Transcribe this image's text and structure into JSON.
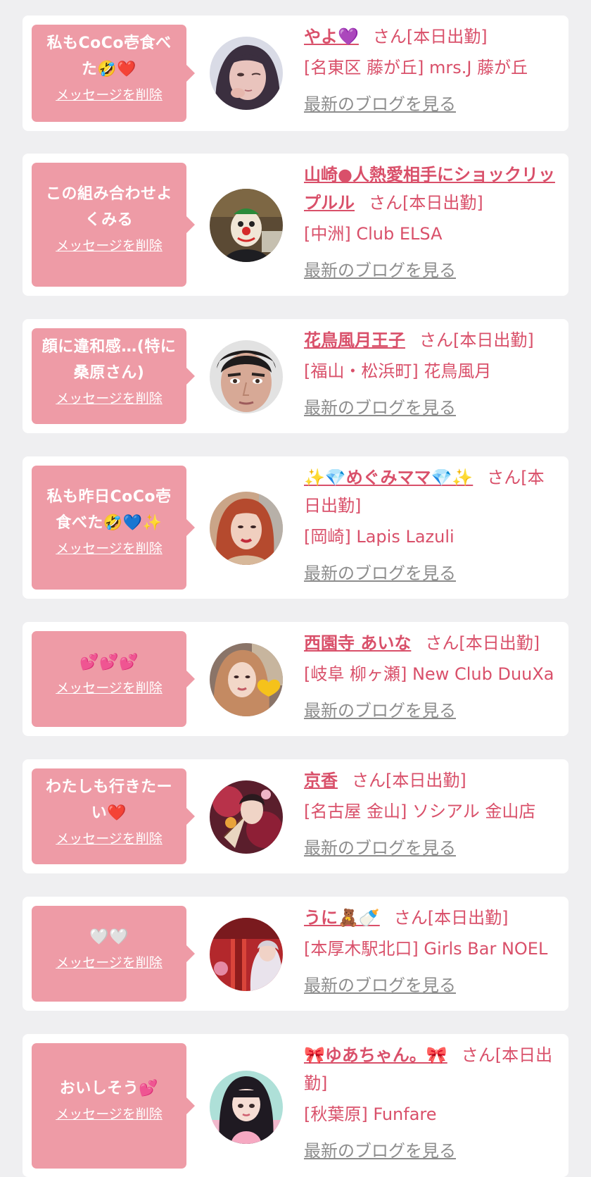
{
  "delete_label": "メッセージを削除",
  "blog_label": "最新のブログを見る",
  "colors": {
    "page_background": "#efeff1",
    "bubble": "#ee9ba6",
    "accent_text": "#d9506a",
    "link_gray": "#8d8d8d"
  },
  "messages": [
    {
      "bubble_lines": [
        "私もCoCo壱食べ",
        "た🤣❤️"
      ],
      "name": "やよ💜",
      "suffix": "さん[本日出勤]",
      "shop": "[名東区 藤が丘] mrs.J 藤が丘",
      "avatar_icon": "portrait-woman-dark-hair"
    },
    {
      "bubble_lines": [
        "この組み合わせよ",
        "くみる"
      ],
      "name": "山崎●人熱愛相手にショックリップルル",
      "suffix": "さん[本日出勤]",
      "shop": "[中洲] Club ELSA",
      "avatar_icon": "portrait-clown-mask"
    },
    {
      "bubble_lines": [
        "顔に違和感…(特に",
        "桑原さん)"
      ],
      "name": "花鳥風月王子",
      "suffix": "さん[本日出勤]",
      "shop": "[福山・松浜町] 花鳥風月",
      "avatar_icon": "portrait-man-face"
    },
    {
      "bubble_lines": [
        "私も昨日CoCo壱",
        "食べた🤣💙✨"
      ],
      "name": "✨💎めぐみママ💎✨",
      "suffix": "さん[本日出勤]",
      "shop": "[岡崎] Lapis Lazuli",
      "avatar_icon": "portrait-woman-red-hair"
    },
    {
      "bubble_lines": [
        "💕💕💕"
      ],
      "name": "西園寺 あいな",
      "suffix": "さん[本日出勤]",
      "shop": "[岐阜 柳ヶ瀬] New Club DuuXa",
      "avatar_icon": "portrait-woman-yellow-heart"
    },
    {
      "bubble_lines": [
        "わたしも行きたー",
        "い❤️"
      ],
      "name": "京香",
      "suffix": "さん[本日出勤]",
      "shop": "[名古屋 金山] ソシアル 金山店",
      "avatar_icon": "portrait-kimono-fan"
    },
    {
      "bubble_lines": [
        "🤍🤍"
      ],
      "name": "うに🧸🍼",
      "suffix": "さん[本日出勤]",
      "shop": "[本厚木駅北口] Girls Bar NOEL",
      "avatar_icon": "portrait-woman-red-interior"
    },
    {
      "bubble_lines": [
        "おいしそう💕"
      ],
      "name": "🎀ゆあちゃん。🎀",
      "suffix": "さん[本日出勤]",
      "shop": "[秋葉原] Funfare",
      "avatar_icon": "portrait-woman-pink-outfit"
    }
  ]
}
